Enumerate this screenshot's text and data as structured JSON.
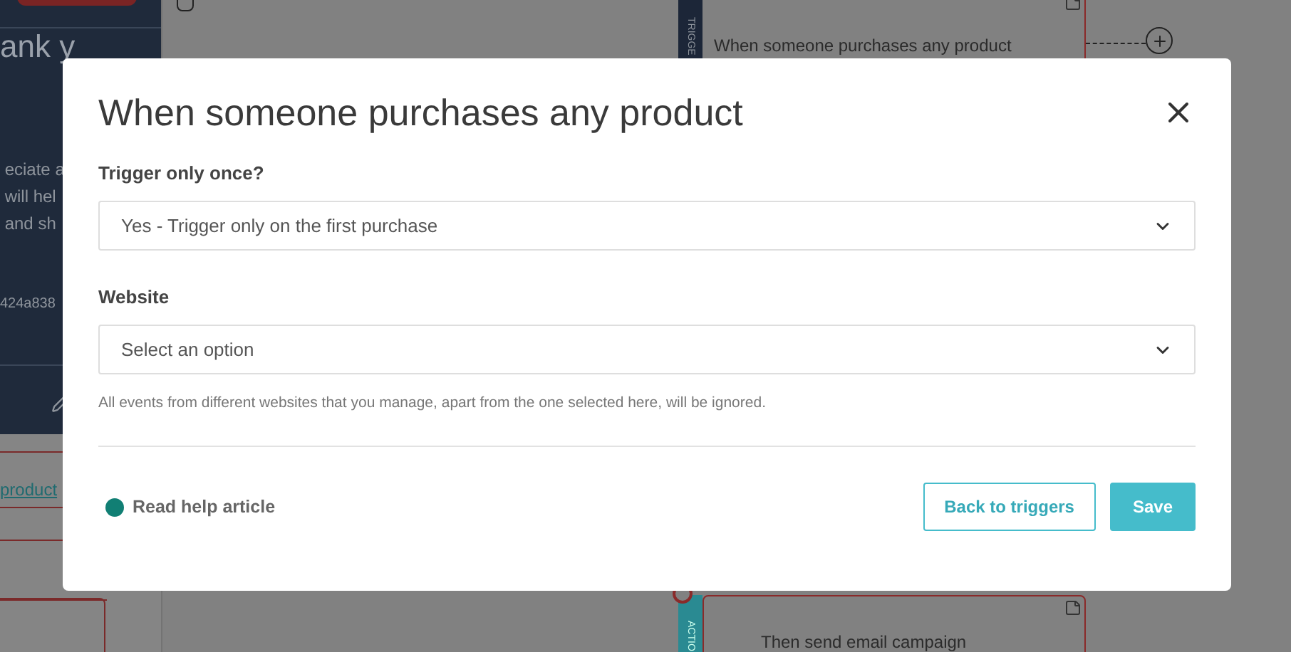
{
  "background": {
    "sidebar": {
      "heading": "ank y",
      "lines": [
        "eciate a",
        "will hel",
        "and sh"
      ],
      "code": "424a838",
      "link": "product"
    },
    "canvas": {
      "trigger_card": {
        "tag": "TRIGGE",
        "title": "When someone purchases any product"
      },
      "action_card": {
        "tag": "ACTIO",
        "title": "Then send email campaign"
      }
    }
  },
  "modal": {
    "title": "When someone purchases any product",
    "fields": [
      {
        "label": "Trigger only once?",
        "value": "Yes - Trigger only on the first purchase"
      },
      {
        "label": "Website",
        "placeholder": "Select an option",
        "hint": "All events from different websites that you manage, apart from the one selected here, will be ignored."
      }
    ],
    "help_link": "Read help article",
    "buttons": [
      {
        "label": "Back to triggers",
        "kind": "secondary"
      },
      {
        "label": "Save",
        "kind": "primary"
      }
    ]
  }
}
